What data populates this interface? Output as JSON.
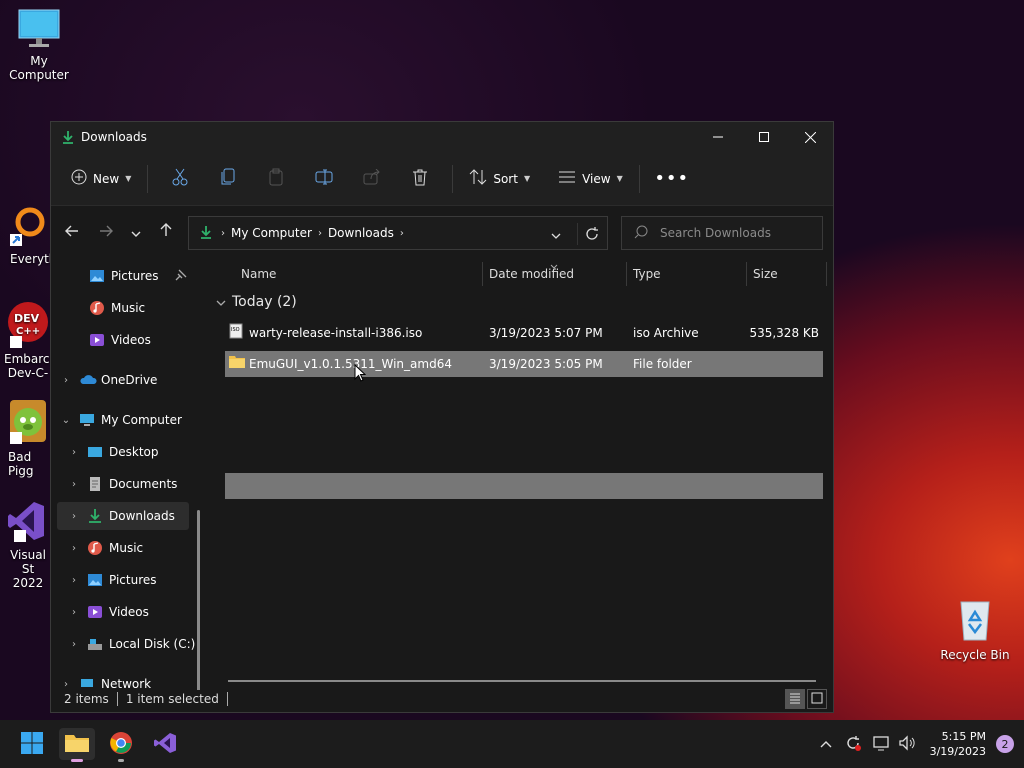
{
  "desktop": {
    "icons": [
      {
        "label": "My Computer"
      },
      {
        "label": "Everyth"
      },
      {
        "label": "Embarca\nDev-C-"
      },
      {
        "label": "Bad Pigg"
      },
      {
        "label": "Visual St\n2022"
      },
      {
        "label": "Recycle Bin"
      }
    ]
  },
  "window": {
    "title": "Downloads",
    "toolbar": {
      "new_label": "New",
      "sort_label": "Sort",
      "view_label": "View"
    },
    "address": {
      "segments": [
        "My Computer",
        "Downloads"
      ]
    },
    "search": {
      "placeholder": "Search Downloads"
    },
    "sidebar": {
      "items": [
        {
          "label": "Pictures"
        },
        {
          "label": "Music"
        },
        {
          "label": "Videos"
        },
        {
          "label": "OneDrive"
        },
        {
          "label": "My Computer"
        },
        {
          "label": "Desktop"
        },
        {
          "label": "Documents"
        },
        {
          "label": "Downloads"
        },
        {
          "label": "Music"
        },
        {
          "label": "Pictures"
        },
        {
          "label": "Videos"
        },
        {
          "label": "Local Disk (C:)"
        },
        {
          "label": "Network"
        }
      ]
    },
    "columns": [
      "Name",
      "Date modified",
      "Type",
      "Size"
    ],
    "group": {
      "label": "Today (2)"
    },
    "files": [
      {
        "name": "warty-release-install-i386.iso",
        "date": "3/19/2023 5:07 PM",
        "type": "iso Archive",
        "size": "535,328 KB"
      },
      {
        "name": "EmuGUI_v1.0.1.5311_Win_amd64",
        "date": "3/19/2023 5:05 PM",
        "type": "File folder",
        "size": ""
      }
    ],
    "status": {
      "items": "2 items",
      "selected": "1 item selected"
    }
  },
  "taskbar": {
    "clock_time": "5:15 PM",
    "clock_date": "3/19/2023",
    "notification_count": "2"
  },
  "colors": {
    "accent_green": "#2fb36b",
    "selection": "#777777",
    "window_bg": "#191919"
  }
}
